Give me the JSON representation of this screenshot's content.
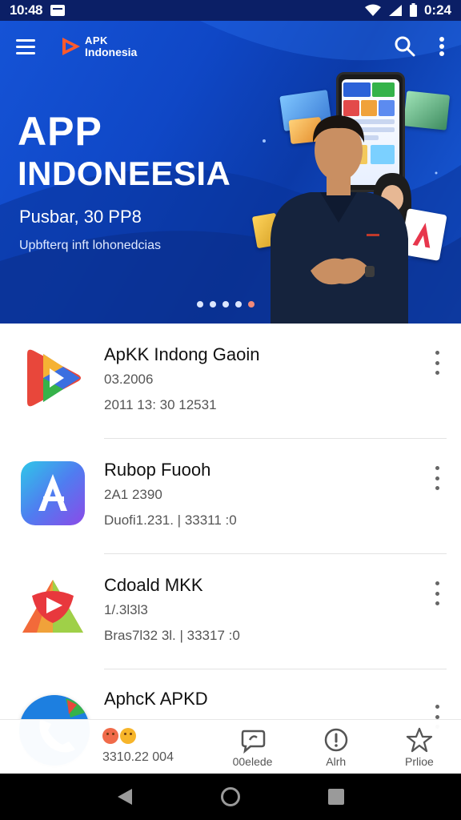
{
  "status_bar": {
    "time": "10:48",
    "battery_time": "0:24"
  },
  "header": {
    "brand_top": "APK",
    "brand_bottom": "Indonesia"
  },
  "hero": {
    "title_line1": "APP",
    "title_line2": "INDONEESIA",
    "subtitle": "Pusbar, 30 PP8",
    "description": "Upbfterq inft lohonedcias",
    "carousel_dots": 5,
    "active_dot": 4
  },
  "apps": [
    {
      "name": "ApKK Indong Gaoin",
      "version": "03.2006",
      "meta": "2011 13: 30 12531"
    },
    {
      "name": "Rubop Fuooh",
      "version": "2A1 2390",
      "meta": "Duofi1.231. | 33311  :0"
    },
    {
      "name": "Cdoald MKK",
      "version": "1/.3l3l3",
      "meta": "Bras7l32 3l. | 33317  :0"
    },
    {
      "name": "AphcK APKD",
      "version": "",
      "meta": "3310.22 004"
    }
  ],
  "bottom_nav": {
    "items": [
      {
        "label": "3310.22 004",
        "icon": "emoji-icon"
      },
      {
        "label": "00elede",
        "icon": "chat-icon"
      },
      {
        "label": "Alrh",
        "icon": "info-icon"
      },
      {
        "label": "Prlioe",
        "icon": "star-icon"
      }
    ]
  },
  "colors": {
    "hero_blue": "#1553d6",
    "status_bar": "#0b1f66",
    "active_dot": "#f08a7a"
  }
}
